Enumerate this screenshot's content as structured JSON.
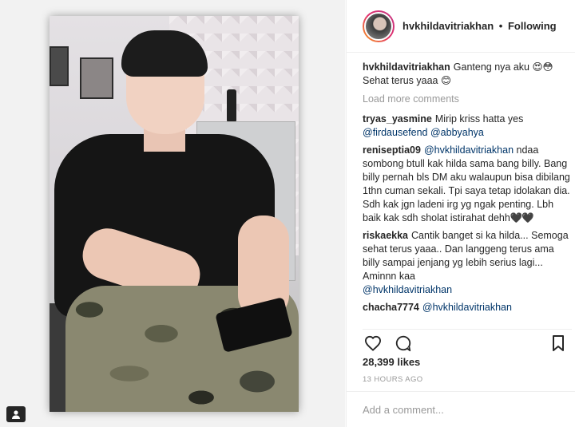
{
  "post": {
    "username": "hvkhildavitriakhan",
    "follow_separator": "•",
    "follow_status": "Following",
    "caption_user": "hvkhildavitriakhan",
    "caption_line1": "Ganteng nya aku",
    "caption_line2": "Sehat terus yaaa",
    "emoji_heart_eyes": "😍",
    "emoji_flushed": "😳",
    "emoji_smile": "😊",
    "load_more": "Load more comments",
    "likes": "28,399 likes",
    "time": "13 HOURS AGO",
    "add_comment_placeholder": "Add a comment..."
  },
  "comments": [
    {
      "user": "tryas_yasmine",
      "text": "Mirip kriss hatta yes",
      "mentions": [
        "@firdausefend",
        "@abbyahya"
      ]
    },
    {
      "user": "reniseptia09",
      "mention": "@hvkhildavitriakhan",
      "text": "ndaa sombong btull kak hilda sama bang billy. Bang billy pernah bls DM aku walaupun bisa dibilang 1thn cuman sekali. Tpi saya tetap idolakan dia. Sdh kak jgn ladeni irg yg ngak penting. Lbh baik kak sdh sholat istirahat dehh",
      "hearts": "🖤🖤"
    },
    {
      "user": "riskaekka",
      "text": "Cantik banget si ka hilda... Semoga sehat terus yaaa.. Dan langgeng terus ama billy sampai jenjang yg lebih serius lagi... Aminnn kaa",
      "mention": "@hvkhildavitriakhan"
    },
    {
      "user": "chacha7774",
      "mention": "@hvkhildavitriakhan"
    }
  ],
  "icons": {
    "like": "heart-icon",
    "comment": "comment-icon",
    "save": "bookmark-icon",
    "profile": "user-tag-icon"
  },
  "colors": {
    "accent_link": "#003569",
    "muted": "#999999",
    "border": "#efefef"
  }
}
